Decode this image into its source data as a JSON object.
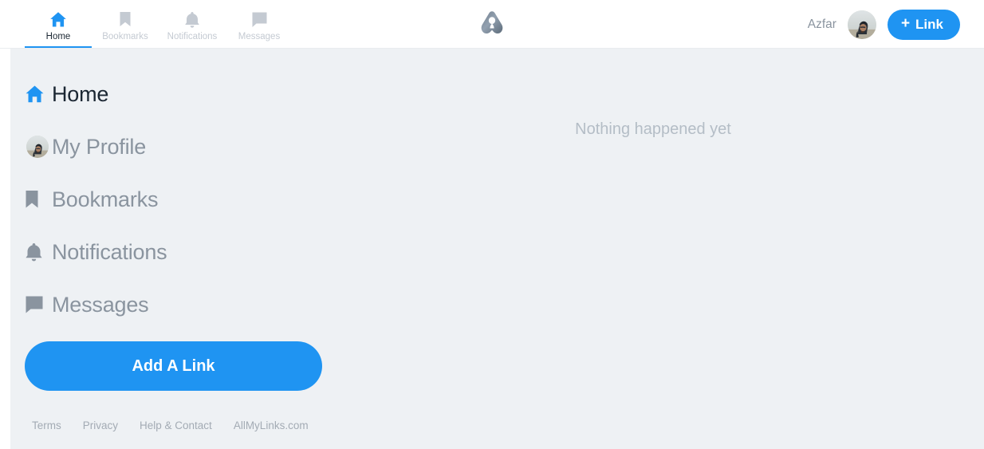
{
  "colors": {
    "accent": "#1f94f2",
    "page_background": "#eef1f4",
    "header_background": "#ffffff",
    "muted_text": "#8a949f",
    "inactive_tab": "#c4cad2",
    "active_text": "#1b2733"
  },
  "header": {
    "logo_name": "allmylinks-logo",
    "tabs": [
      {
        "label": "Home",
        "icon": "home-icon",
        "active": true
      },
      {
        "label": "Bookmarks",
        "icon": "bookmark-icon",
        "active": false
      },
      {
        "label": "Notifications",
        "icon": "bell-icon",
        "active": false
      },
      {
        "label": "Messages",
        "icon": "message-icon",
        "active": false
      }
    ],
    "username": "Azfar",
    "avatar_name": "user-avatar",
    "add_link_button": {
      "plus": "+",
      "label": "Link"
    }
  },
  "sidebar": {
    "items": [
      {
        "label": "Home",
        "icon": "home-icon",
        "active": true
      },
      {
        "label": "My Profile",
        "icon": "user-avatar",
        "active": false
      },
      {
        "label": "Bookmarks",
        "icon": "bookmark-icon",
        "active": false
      },
      {
        "label": "Notifications",
        "icon": "bell-icon",
        "active": false
      },
      {
        "label": "Messages",
        "icon": "message-icon",
        "active": false
      }
    ],
    "add_link_button_label": "Add A Link",
    "footer_links": [
      {
        "label": "Terms"
      },
      {
        "label": "Privacy"
      },
      {
        "label": "Help & Contact"
      },
      {
        "label": "AllMyLinks.com"
      }
    ]
  },
  "main": {
    "empty_state_text": "Nothing happened yet"
  }
}
